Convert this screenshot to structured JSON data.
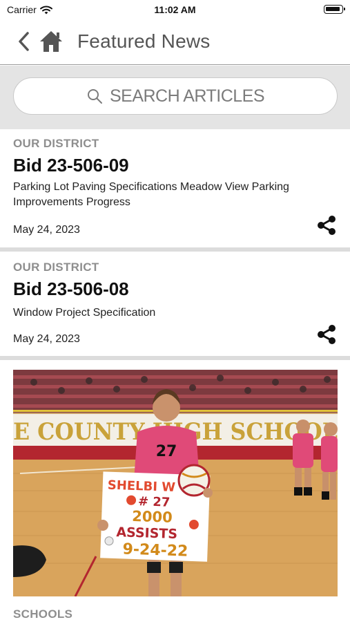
{
  "status_bar": {
    "carrier": "Carrier",
    "time": "11:02 AM"
  },
  "header": {
    "title": "Featured News"
  },
  "search": {
    "placeholder": "SEARCH ARTICLES"
  },
  "articles": [
    {
      "category": "OUR DISTRICT",
      "title": "Bid 23-506-09",
      "description": "Parking Lot Paving Specifications Meadow View Parking Improvements Progress",
      "date": "May 24, 2023"
    },
    {
      "category": "OUR DISTRICT",
      "title": "Bid 23-506-08",
      "description": "Window Project Specification",
      "date": "May 24, 2023"
    },
    {
      "category": "SCHOOLS",
      "photo": {
        "banner_text": "E COUNTY HIGH SCHOOL",
        "poster_lines": [
          "SHELBI W",
          "# 27",
          "2000",
          "ASSISTS",
          "9-24-22"
        ],
        "jersey_number": "27"
      }
    }
  ],
  "colors": {
    "accent": "#555555",
    "category_gray": "#8e8e8e",
    "divider": "#dcdcdc"
  },
  "icons": [
    "wifi-icon",
    "battery-icon",
    "back-chevron-icon",
    "home-icon",
    "search-icon",
    "share-icon"
  ]
}
